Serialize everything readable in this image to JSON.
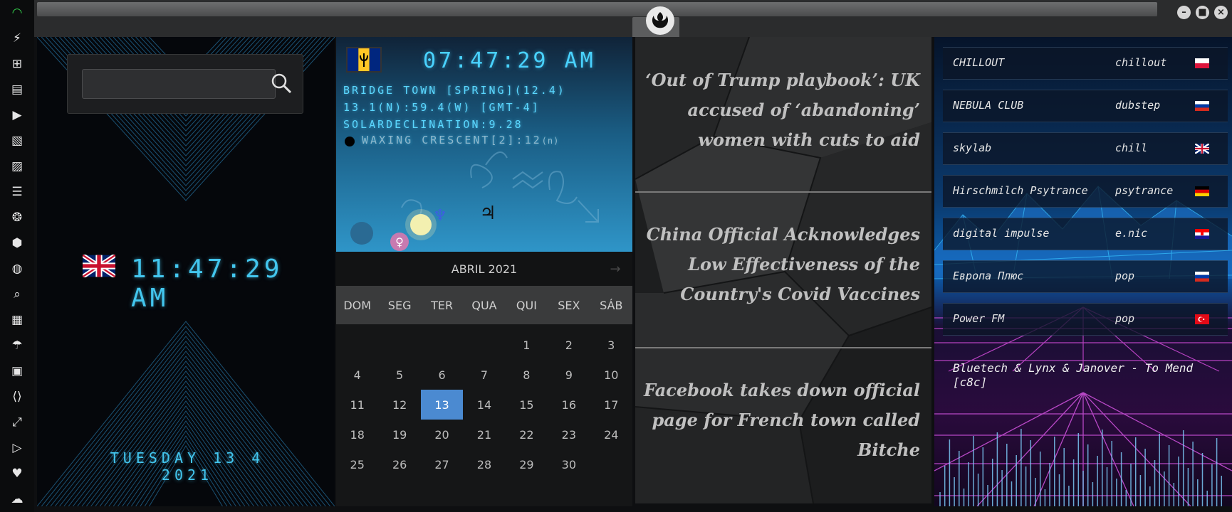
{
  "sidebar": {
    "icons": [
      "wifi-icon",
      "bolt-icon",
      "windows-icon",
      "archive-icon",
      "play-icon",
      "map-book-icon",
      "image-icon",
      "newspaper-icon",
      "rebel-icon",
      "empire-icon",
      "globe-icon",
      "search-icon",
      "map-icon",
      "umbrella-icon",
      "contacts-icon",
      "code-icon",
      "expand-icon",
      "youtube-icon",
      "heart-icon",
      "cloud-icon"
    ]
  },
  "window": {
    "buttons": {
      "minimize": "–",
      "maximize": "■",
      "close": "×"
    }
  },
  "clock": {
    "search_placeholder": "",
    "uk_time": "11:47:29  AM",
    "date": "TUESDAY 13 4 2021"
  },
  "astro": {
    "time": "07:47:29  AM",
    "line1": "BRIDGE TOWN [SPRING](12.4)",
    "line2": "13.1(N):59.4(W) [GMT-4]",
    "line3": "SOLARDECLINATION:9.28",
    "moon": "WAXING CRESCENT[2]:12",
    "moon_suffix": "(n)"
  },
  "calendar": {
    "month": "ABRIL 2021",
    "prev": "←",
    "next": "→",
    "dow": [
      "DOM",
      "SEG",
      "TER",
      "QUA",
      "QUI",
      "SEX",
      "SÁB"
    ],
    "leading_blanks": 4,
    "days": [
      "1",
      "2",
      "3",
      "4",
      "5",
      "6",
      "7",
      "8",
      "9",
      "10",
      "11",
      "12",
      "13",
      "14",
      "15",
      "16",
      "17",
      "18",
      "19",
      "20",
      "21",
      "22",
      "23",
      "24",
      "25",
      "26",
      "27",
      "28",
      "29",
      "30"
    ],
    "selected": "13"
  },
  "news": {
    "items": [
      "‘Out of Trump playbook’: UK accused of ‘abandoning’ women with cuts to aid",
      "China Official Acknowledges Low Effectiveness of the Country's Covid Vaccines",
      "Facebook takes down official page for French town called Bitche"
    ]
  },
  "radio": {
    "stations": [
      {
        "name": "CHILLOUT",
        "genre": "chillout",
        "flag": "poland"
      },
      {
        "name": "NEBULA CLUB",
        "genre": "dubstep",
        "flag": "russia"
      },
      {
        "name": "skylab",
        "genre": "chill",
        "flag": "uk"
      },
      {
        "name": "Hirschmilch Psytrance",
        "genre": "psytrance",
        "flag": "germany"
      },
      {
        "name": "digital impulse",
        "genre": "e.nic",
        "flag": "croatia"
      },
      {
        "name": "Европа Плюс",
        "genre": "pop",
        "flag": "russia"
      },
      {
        "name": "Power FM",
        "genre": "pop",
        "flag": "turkey"
      }
    ],
    "now_playing": "Bluetech & Lynx & Janover - To Mend [c8c]"
  },
  "colors": {
    "lcd": "#43c6ee",
    "selected_day": "#4b8ad1",
    "wifi": "#33d04b"
  }
}
